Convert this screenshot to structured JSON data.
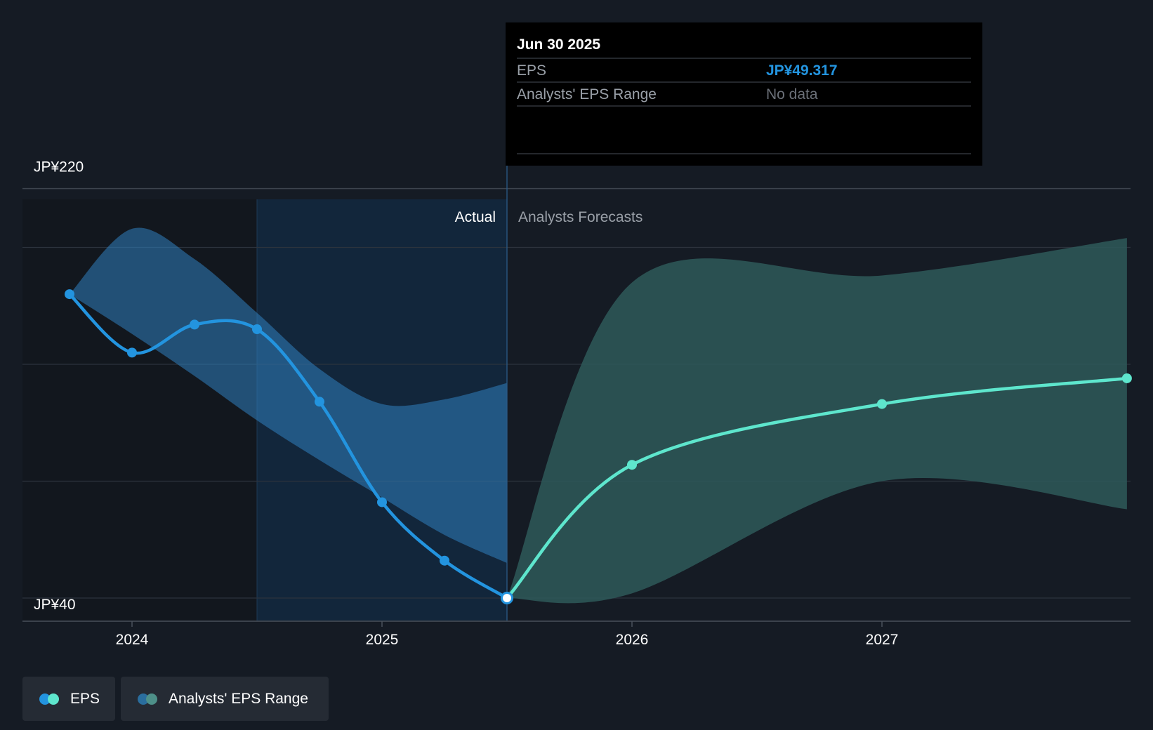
{
  "chart_data": {
    "type": "line",
    "y_ticks": [
      {
        "label": "JP¥220",
        "value": 220
      },
      {
        "label": "JP¥40",
        "value": 40
      }
    ],
    "ylim": [
      40,
      220
    ],
    "xlim": [
      2023.6,
      2027.98
    ],
    "x_ticks": [
      {
        "label": "2024",
        "value": 2024.0
      },
      {
        "label": "2025",
        "value": 2025.0
      },
      {
        "label": "2026",
        "value": 2026.0
      },
      {
        "label": "2027",
        "value": 2027.0
      }
    ],
    "grid_values": [
      40,
      90,
      140,
      190
    ],
    "regions": {
      "actual_label": "Actual",
      "forecast_label": "Analysts Forecasts",
      "split_x": 2025.5,
      "shade_start_x": 2024.5
    },
    "series": [
      {
        "name": "EPS",
        "color": "#2394df",
        "x": [
          2023.75,
          2024.0,
          2024.25,
          2024.5,
          2024.75,
          2025.0,
          2025.25,
          2025.5
        ],
        "y": [
          170,
          145,
          157,
          155,
          124,
          81,
          56,
          40
        ]
      },
      {
        "name": "EPS",
        "color": "#5ee6cd",
        "x": [
          2025.5,
          2026.0,
          2027.0,
          2027.98
        ],
        "y": [
          40,
          97,
          123,
          134
        ]
      }
    ],
    "ranges": [
      {
        "name": "Analysts' EPS Range",
        "color": "#2f7fbf",
        "x": [
          2023.75,
          2024.0,
          2024.25,
          2024.5,
          2024.75,
          2025.0,
          2025.25,
          2025.5
        ],
        "high": [
          170,
          198,
          185,
          162,
          138,
          123,
          125,
          132
        ],
        "low": [
          170,
          153,
          135,
          116,
          99,
          83,
          67,
          55
        ]
      },
      {
        "name": "Analysts' EPS Range",
        "color": "#2e5959",
        "x": [
          2025.5,
          2026.0,
          2027.0,
          2027.98
        ],
        "high": [
          40,
          175,
          178,
          194
        ],
        "low": [
          40,
          42,
          90,
          78
        ]
      }
    ]
  },
  "tooltip": {
    "date": "Jun 30 2025",
    "rows": [
      {
        "label": "EPS",
        "value": "JP¥49.317",
        "value_color": "#2394df"
      },
      {
        "label": "Analysts' EPS Range",
        "value": "No data",
        "value_color": "#6b7078"
      }
    ]
  },
  "legend": [
    {
      "label": "EPS",
      "colors": [
        "#2394df",
        "#5ee6cd"
      ]
    },
    {
      "label": "Analysts' EPS Range",
      "colors": [
        "#2a6e9e",
        "#4e9089"
      ]
    }
  ]
}
